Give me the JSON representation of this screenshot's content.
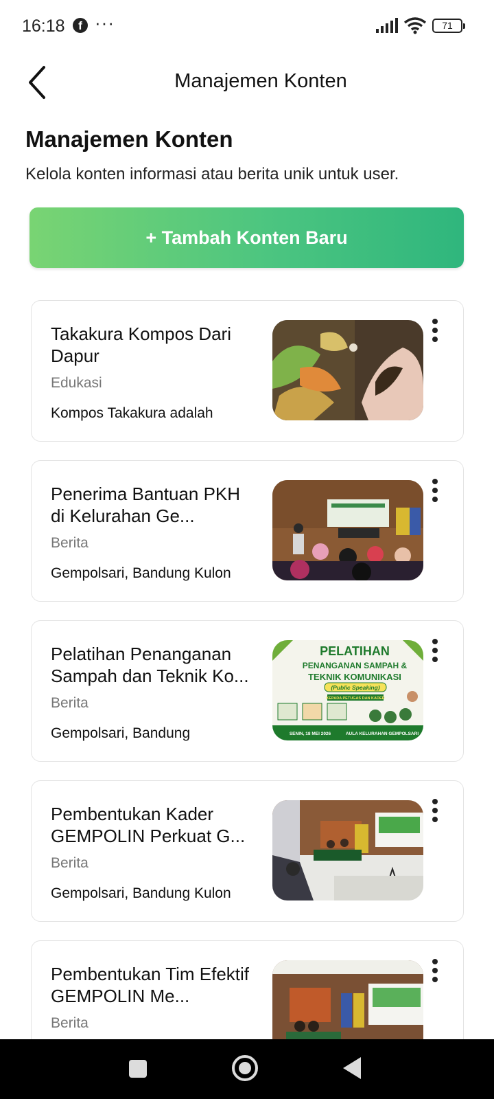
{
  "status_bar": {
    "time": "16:18",
    "facebook_glyph": "f",
    "more": "···",
    "battery": "71"
  },
  "app_bar": {
    "title": "Manajemen Konten"
  },
  "page": {
    "heading": "Manajemen Konten",
    "description": "Kelola konten informasi atau berita unik untuk user.",
    "add_button": "+ Tambah Konten Baru"
  },
  "cards": [
    {
      "title": "Takakura Kompos Dari Dapur",
      "category": "Edukasi",
      "location": "Kompos Takakura adalah",
      "thumb": "compost-photo"
    },
    {
      "title": "Penerima Bantuan PKH di Kelurahan Ge...",
      "category": "Berita",
      "location": "Gempolsari, Bandung Kulon",
      "thumb": "meeting-photo"
    },
    {
      "title": "Pelatihan Penanganan Sampah dan Teknik Ko...",
      "category": "Berita",
      "location": "Gempolsari, Bandung",
      "thumb": "training-poster"
    },
    {
      "title": "Pembentukan Kader GEMPOLIN Perkuat G...",
      "category": "Berita",
      "location": "Gempolsari, Bandung Kulon",
      "thumb": "hall-photo"
    },
    {
      "title": "Pembentukan Tim Efektif GEMPOLIN Me...",
      "category": "Berita",
      "location": "",
      "thumb": "hall-photo-2"
    }
  ],
  "poster": {
    "line1": "PELATIHAN",
    "line2": "PENANGANAN SAMPAH &",
    "line3": "TEKNIK KOMUNIKASI",
    "line4": "(Public Speaking)",
    "line5": "KEPADA PETUGAS DAN KADER",
    "footer_left": "SENIN, 18 MEI 2026",
    "footer_right": "AULA KELURAHAN GEMPOLSARI"
  },
  "colors": {
    "accent_start": "#79d473",
    "accent_end": "#2fb67d",
    "poster_green": "#1e7a2c"
  }
}
